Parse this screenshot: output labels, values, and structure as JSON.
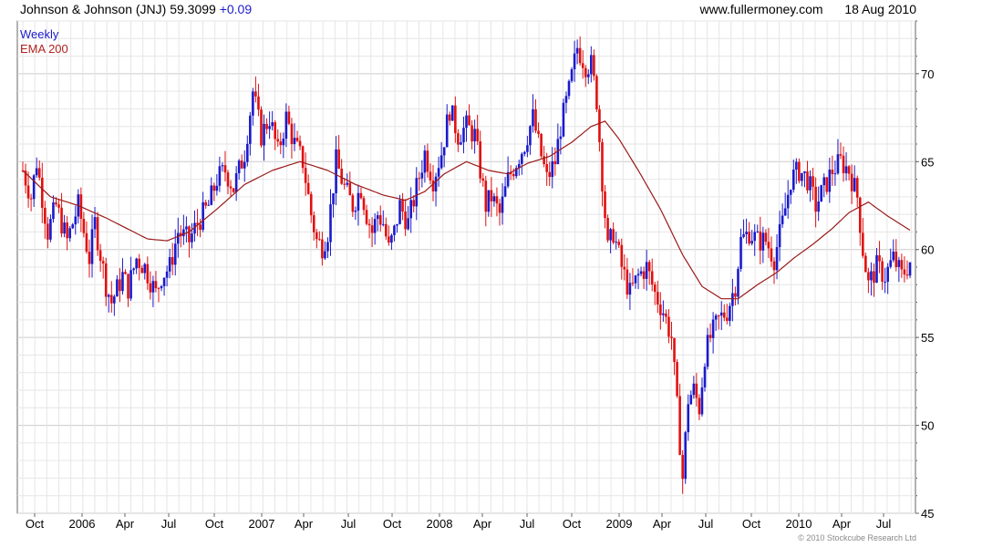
{
  "header": {
    "title_text": "Johnson & Johnson (JNJ) 59.3099",
    "change": "+0.09",
    "site": "www.fullermoney.com",
    "date": "18 Aug 2010"
  },
  "legend": {
    "series1": "Weekly",
    "series2": "EMA 200"
  },
  "footer": {
    "copyright": "© 2010 Stockcube Research Ltd"
  },
  "colors": {
    "up": "#1a1acc",
    "down": "#e01010",
    "ema": "#9a1a1a",
    "grid": "#e6e6e6",
    "axis": "#666666"
  },
  "chart_data": {
    "type": "candlestick",
    "ylim": [
      45,
      73
    ],
    "y_ticks": [
      45,
      50,
      55,
      60,
      65,
      70
    ],
    "x_ticks": [
      "Oct",
      "2006",
      "Apr",
      "Jul",
      "Oct",
      "2007",
      "Apr",
      "Jul",
      "Oct",
      "2008",
      "Apr",
      "Jul",
      "Oct",
      "2009",
      "Apr",
      "Jul",
      "Oct",
      "2010",
      "Apr",
      "Jul"
    ],
    "series": [
      {
        "name": "Weekly",
        "kind": "price",
        "points": [
          [
            0,
            64.5
          ],
          [
            3,
            63.0
          ],
          [
            5,
            65.0
          ],
          [
            9,
            61.0
          ],
          [
            12,
            62.5
          ],
          [
            16,
            60.5
          ],
          [
            20,
            62.5
          ],
          [
            24,
            59.5
          ],
          [
            26,
            61.5
          ],
          [
            30,
            58.0
          ],
          [
            32,
            57.0
          ],
          [
            36,
            58.5
          ],
          [
            38,
            57.8
          ],
          [
            41,
            59.5
          ],
          [
            44,
            59.0
          ],
          [
            48,
            57.5
          ],
          [
            50,
            58.5
          ],
          [
            53,
            59.0
          ],
          [
            56,
            61.0
          ],
          [
            60,
            60.5
          ],
          [
            63,
            61.5
          ],
          [
            67,
            62.5
          ],
          [
            70,
            64.0
          ],
          [
            73,
            64.5
          ],
          [
            76,
            63.5
          ],
          [
            80,
            65.5
          ],
          [
            83,
            69.0
          ],
          [
            86,
            66.5
          ],
          [
            89,
            67.5
          ],
          [
            92,
            65.5
          ],
          [
            95,
            67.5
          ],
          [
            98,
            66.0
          ],
          [
            101,
            65.0
          ],
          [
            104,
            62.0
          ],
          [
            106,
            60.5
          ],
          [
            108,
            60.2
          ],
          [
            110,
            61.0
          ],
          [
            113,
            65.0
          ],
          [
            116,
            63.5
          ],
          [
            119,
            62.5
          ],
          [
            122,
            63.5
          ],
          [
            124,
            62.0
          ],
          [
            126,
            61.0
          ],
          [
            128,
            62.0
          ],
          [
            130,
            61.5
          ],
          [
            132,
            60.0
          ],
          [
            134,
            61.0
          ],
          [
            136,
            62.5
          ],
          [
            139,
            61.5
          ],
          [
            142,
            63.5
          ],
          [
            145,
            65.5
          ],
          [
            148,
            64.0
          ],
          [
            151,
            65.5
          ],
          [
            154,
            68.0
          ],
          [
            157,
            66.5
          ],
          [
            160,
            67.0
          ],
          [
            163,
            66.5
          ],
          [
            165,
            64.5
          ],
          [
            167,
            62.5
          ],
          [
            169,
            63.0
          ],
          [
            172,
            62.0
          ],
          [
            175,
            64.0
          ],
          [
            178,
            65.0
          ],
          [
            181,
            66.0
          ],
          [
            184,
            67.5
          ],
          [
            186,
            66.0
          ],
          [
            189,
            64.0
          ],
          [
            192,
            65.0
          ],
          [
            194,
            67.0
          ],
          [
            197,
            69.0
          ],
          [
            200,
            71.5
          ],
          [
            203,
            70.5
          ],
          [
            205,
            70.5
          ],
          [
            207,
            68.5
          ],
          [
            209,
            64.0
          ],
          [
            211,
            60.0
          ],
          [
            213,
            61.0
          ],
          [
            216,
            59.0
          ],
          [
            219,
            57.5
          ],
          [
            222,
            58.5
          ],
          [
            225,
            59.0
          ],
          [
            228,
            57.5
          ],
          [
            231,
            56.5
          ],
          [
            234,
            55.0
          ],
          [
            236,
            51.0
          ],
          [
            238,
            47.0
          ],
          [
            240,
            51.5
          ],
          [
            242,
            52.0
          ],
          [
            244,
            51.0
          ],
          [
            246,
            54.0
          ],
          [
            248,
            55.0
          ],
          [
            251,
            56.0
          ],
          [
            254,
            56.5
          ],
          [
            257,
            58.0
          ],
          [
            259,
            60.5
          ],
          [
            262,
            61.0
          ],
          [
            265,
            60.5
          ],
          [
            268,
            60.5
          ],
          [
            271,
            59.5
          ],
          [
            274,
            61.5
          ],
          [
            277,
            64.0
          ],
          [
            280,
            64.5
          ],
          [
            283,
            64.0
          ],
          [
            286,
            62.5
          ],
          [
            289,
            63.5
          ],
          [
            292,
            64.5
          ],
          [
            295,
            65.0
          ],
          [
            298,
            64.5
          ],
          [
            301,
            63.0
          ],
          [
            303,
            60.0
          ],
          [
            305,
            58.0
          ],
          [
            308,
            59.0
          ],
          [
            311,
            58.5
          ],
          [
            314,
            59.5
          ],
          [
            317,
            58.5
          ],
          [
            320,
            59.3
          ]
        ]
      },
      {
        "name": "EMA 200",
        "kind": "ema",
        "points": [
          [
            0,
            64.5
          ],
          [
            10,
            63.0
          ],
          [
            20,
            62.5
          ],
          [
            30,
            61.8
          ],
          [
            40,
            61.0
          ],
          [
            45,
            60.6
          ],
          [
            52,
            60.5
          ],
          [
            60,
            61.0
          ],
          [
            70,
            62.3
          ],
          [
            80,
            63.7
          ],
          [
            90,
            64.5
          ],
          [
            100,
            65.0
          ],
          [
            110,
            64.5
          ],
          [
            120,
            63.7
          ],
          [
            130,
            63.1
          ],
          [
            138,
            62.8
          ],
          [
            145,
            63.3
          ],
          [
            152,
            64.3
          ],
          [
            160,
            65.0
          ],
          [
            168,
            64.5
          ],
          [
            175,
            64.3
          ],
          [
            182,
            64.9
          ],
          [
            190,
            65.3
          ],
          [
            198,
            66.1
          ],
          [
            205,
            67.0
          ],
          [
            210,
            67.3
          ],
          [
            215,
            66.3
          ],
          [
            222,
            64.5
          ],
          [
            230,
            62.3
          ],
          [
            238,
            59.7
          ],
          [
            245,
            57.9
          ],
          [
            252,
            57.2
          ],
          [
            258,
            57.2
          ],
          [
            265,
            58.0
          ],
          [
            272,
            58.7
          ],
          [
            278,
            59.5
          ],
          [
            285,
            60.3
          ],
          [
            292,
            61.2
          ],
          [
            298,
            62.1
          ],
          [
            305,
            62.7
          ],
          [
            312,
            61.9
          ],
          [
            320,
            61.1
          ]
        ]
      }
    ]
  }
}
